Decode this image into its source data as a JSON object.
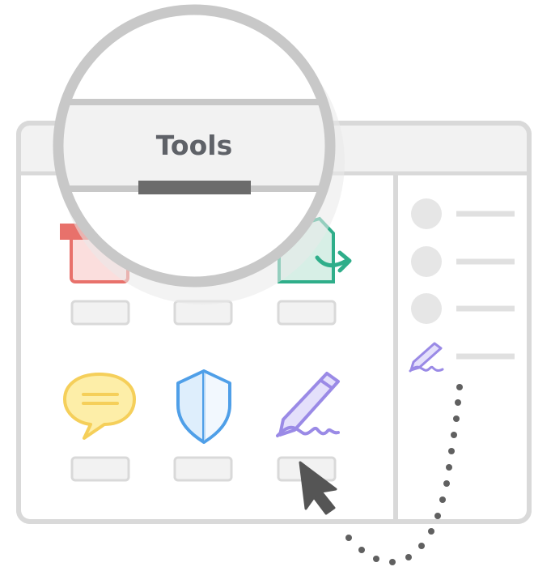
{
  "magnifier": {
    "tab_label": "Tools"
  },
  "colors": {
    "frame": "#d9d9d9",
    "frame_fill": "#f2f2f2",
    "magnifier_ring": "#c8c8c8",
    "tab_underline": "#6b6b6b",
    "red_tool": "#e8716b",
    "green_tool": "#2fae8a",
    "comment_tool": "#f5cf5a",
    "protect_tool": "#4f9fe8",
    "sign_tool": "#9a8ae6",
    "cursor": "#555555",
    "dotted_path": "#606060"
  },
  "tools": [
    {
      "name": "create-pdf-icon"
    },
    {
      "name": "edit-pdf-icon"
    },
    {
      "name": "export-pdf-icon"
    },
    {
      "name": "comment-icon"
    },
    {
      "name": "protect-icon"
    },
    {
      "name": "fill-and-sign-icon"
    }
  ],
  "side_panel": {
    "items": [
      "tool-1",
      "tool-2",
      "tool-3",
      "fill-and-sign"
    ]
  }
}
